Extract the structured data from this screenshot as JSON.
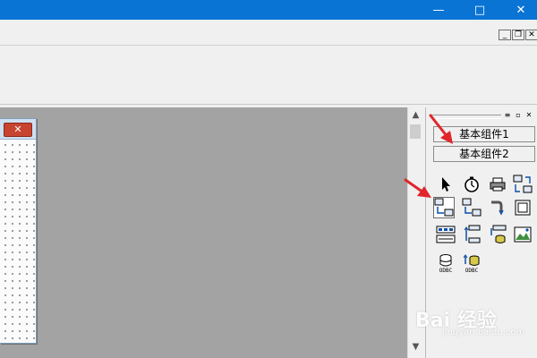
{
  "window": {
    "minimize_glyph": "—",
    "maximize_glyph": "□",
    "close_glyph": "✕"
  },
  "mdi_controls": {
    "minimize": "_",
    "restore": "❐",
    "close": "✕"
  },
  "form": {
    "close_glyph": "✕"
  },
  "scrollbar": {
    "up_glyph": "▲",
    "down_glyph": "▼"
  },
  "component_panel": {
    "tabs": [
      {
        "label": "基本组件1"
      },
      {
        "label": "基本组件2"
      }
    ],
    "tools": [
      {
        "icon": "pointer-icon"
      },
      {
        "icon": "timer-icon"
      },
      {
        "icon": "printer-icon"
      },
      {
        "icon": "data-exchange-icon"
      },
      {
        "icon": "client-socket-icon",
        "selected": true
      },
      {
        "icon": "server-socket-icon"
      },
      {
        "icon": "pipe-icon"
      },
      {
        "icon": "frame-icon"
      },
      {
        "icon": "media-control-icon"
      },
      {
        "icon": "data-source-icon"
      },
      {
        "icon": "database-provider-icon"
      },
      {
        "icon": "picture-box-icon"
      },
      {
        "icon": "odbc-database-icon",
        "label": "ODBC"
      },
      {
        "icon": "odbc-provider-icon",
        "label": "ODBC"
      }
    ]
  },
  "watermark": {
    "text": "Bai 经验",
    "sub": "jingyan.baidu.com"
  },
  "colors": {
    "title_bar": "#0a74d4",
    "workspace": "#a3a3a3",
    "annotation_arrow": "#e0262a"
  }
}
